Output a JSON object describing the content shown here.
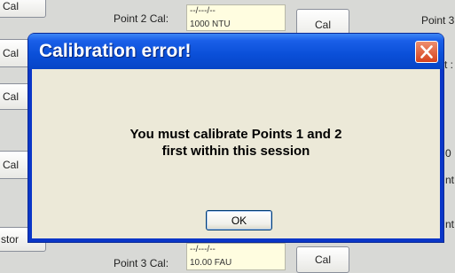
{
  "background": {
    "left_buttons": [
      "Cal",
      "Cal",
      "Cal",
      "Cal",
      "stor"
    ],
    "point2_label": "Point 2 Cal:",
    "point2_value": "--/---/--",
    "point2_value2": "1000 NTU",
    "point2_button": "Cal",
    "point3_label": "Point 3 Cal:",
    "point3_value": "--/---/--",
    "point3_value2": "10.00 FAU",
    "point3_button": "Cal",
    "right_top": "Point 3",
    "right_partials": [
      "t :",
      "0",
      "nt",
      "nt"
    ]
  },
  "dialog": {
    "title": "Calibration error!",
    "message_line1": "You must calibrate Points 1 and 2",
    "message_line2": "first within this session",
    "ok_label": "OK"
  },
  "colors": {
    "title_bar": "#0a4fd8",
    "close_button": "#d6421c",
    "dialog_body": "#ece9d8"
  }
}
